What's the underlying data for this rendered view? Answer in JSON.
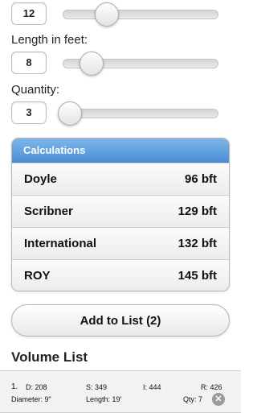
{
  "sliders": [
    {
      "label": "",
      "value": "12",
      "level": 0.28
    },
    {
      "label": "Length in feet:",
      "value": "8",
      "level": 0.18
    },
    {
      "label": "Quantity:",
      "value": "3",
      "level": 0.04
    }
  ],
  "calculations": {
    "header": "Calculations",
    "rows": [
      {
        "name": "Doyle",
        "value": "96 bft"
      },
      {
        "name": "Scribner",
        "value": "129 bft"
      },
      {
        "name": "International",
        "value": "132 bft"
      },
      {
        "name": "ROY",
        "value": "145 bft"
      }
    ]
  },
  "add_button": {
    "label": "Add to List (2)"
  },
  "volume_list": {
    "title": "Volume List",
    "items": [
      {
        "index": "1.",
        "d": "D: 208",
        "s": "S: 349",
        "i": "I: 444",
        "r": "R: 426",
        "diameter": "Diameter: 9\"",
        "length": "Length: 19'",
        "qty": "Qty: 7"
      }
    ]
  },
  "colors": {
    "header_blue": "#4a90d6",
    "delete_icon": "#9a9a9a"
  },
  "icons": {
    "delete": "close-circle-icon"
  }
}
